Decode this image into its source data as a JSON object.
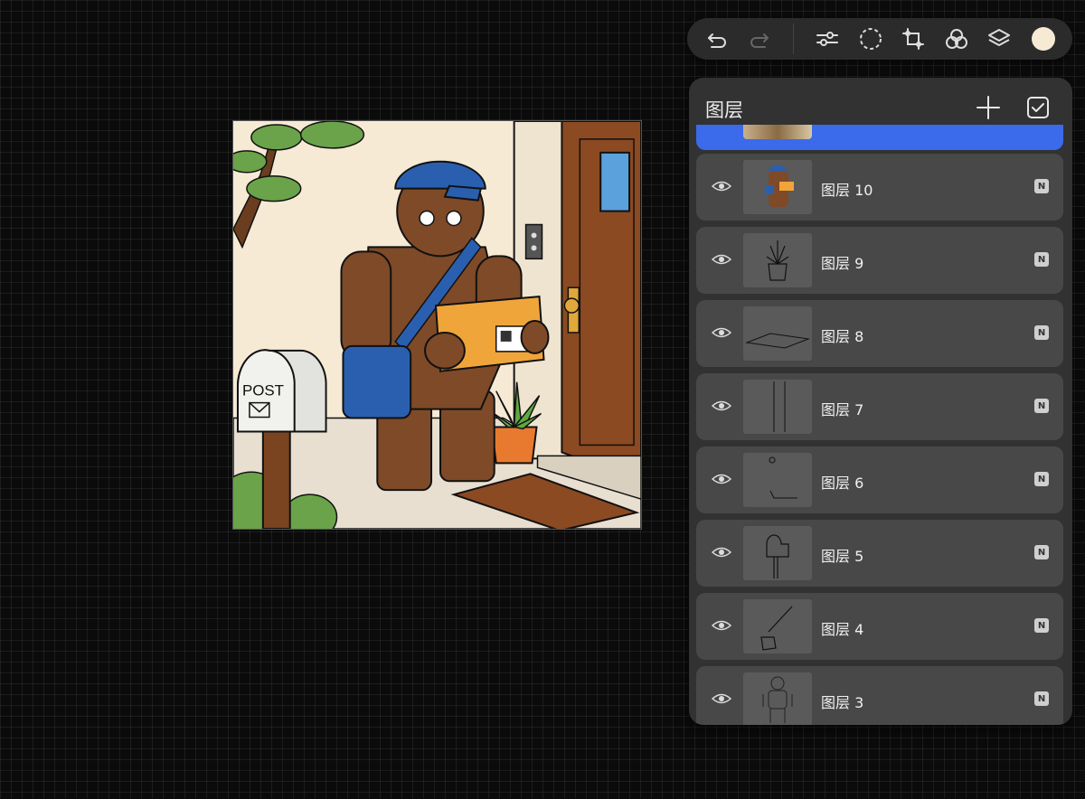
{
  "toolbar": {
    "undo_icon": "undo-icon",
    "redo_icon": "redo-icon",
    "adjustments_icon": "sliders-icon",
    "selection_icon": "selection-icon",
    "transform_icon": "transform-icon",
    "blend_icon": "circles-icon",
    "layers_icon": "layers-icon",
    "current_color": "#f6ead5"
  },
  "artwork": {
    "mailbox_label": "POST"
  },
  "layers_panel": {
    "title": "图层",
    "add_icon": "plus-icon",
    "select_icon": "checkbox-icon",
    "active_color": "#3b6bea",
    "layers": [
      {
        "name": "图层 10",
        "blend": "N",
        "visible": true
      },
      {
        "name": "图层 9",
        "blend": "N",
        "visible": true
      },
      {
        "name": "图层 8",
        "blend": "N",
        "visible": true
      },
      {
        "name": "图层 7",
        "blend": "N",
        "visible": true
      },
      {
        "name": "图层 6",
        "blend": "N",
        "visible": true
      },
      {
        "name": "图层 5",
        "blend": "N",
        "visible": true
      },
      {
        "name": "图层 4",
        "blend": "N",
        "visible": true
      },
      {
        "name": "图层 3",
        "blend": "N",
        "visible": true
      }
    ]
  }
}
